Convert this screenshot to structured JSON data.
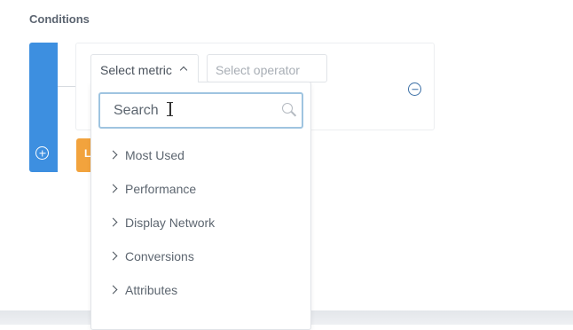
{
  "section": {
    "title": "Conditions"
  },
  "orange_button": {
    "label": "L"
  },
  "metric_select": {
    "label": "Select metric"
  },
  "operator_select": {
    "placeholder": "Select operator"
  },
  "search": {
    "placeholder": "Search",
    "value": ""
  },
  "categories": [
    {
      "label": "Most Used"
    },
    {
      "label": "Performance"
    },
    {
      "label": "Display Network"
    },
    {
      "label": "Conversions"
    },
    {
      "label": "Attributes"
    }
  ],
  "icons": {
    "add": "plus-circle-icon",
    "remove": "minus-circle-icon",
    "search": "search-icon",
    "expand": "chevron-up-icon",
    "category": "chevron-right-icon"
  },
  "colors": {
    "blue_bar": "#3d8fe0",
    "orange_button": "#f2a33d",
    "search_focus_border": "#9fc4e0",
    "remove_icon": "#3a6ea5"
  }
}
